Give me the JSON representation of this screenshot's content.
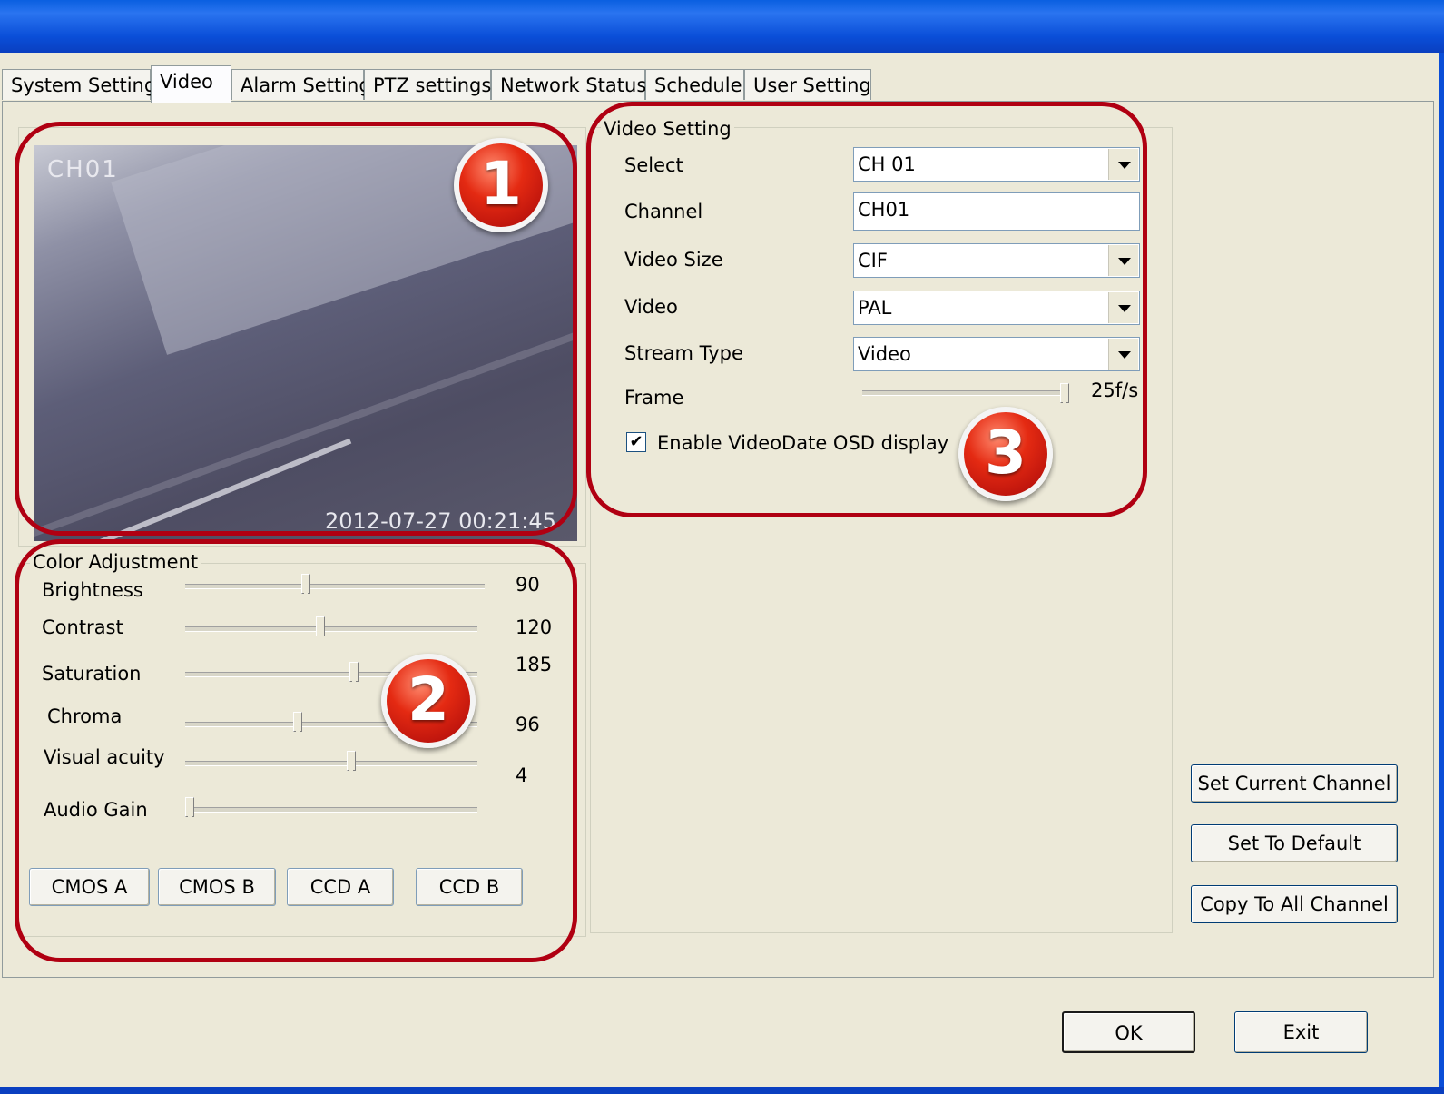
{
  "tabs": [
    "System Setting",
    "Video",
    "Alarm Setting",
    "PTZ settings",
    "Network Status",
    "Schedule",
    "User Setting"
  ],
  "active_tab": "Video",
  "video_preview": {
    "channel_osd": "CH01",
    "timestamp_osd": "2012-07-27 00:21:45"
  },
  "badges": [
    "1",
    "2",
    "3"
  ],
  "color_adjustment": {
    "title": "Color Adjustment",
    "sliders": [
      {
        "label": "Brightness",
        "value": "90",
        "level": 0.4
      },
      {
        "label": "Contrast",
        "value": "120",
        "level": 0.46
      },
      {
        "label": "Saturation",
        "value": "185",
        "level": 0.58
      },
      {
        "label": "Chroma",
        "value": "96",
        "level": 0.38
      },
      {
        "label": "Visual acuity",
        "value": "4",
        "level": 0.57
      },
      {
        "label": "Audio Gain",
        "value": "",
        "level": 0.0
      }
    ],
    "presets": [
      "CMOS A",
      "CMOS B",
      "CCD A",
      "CCD B"
    ]
  },
  "video_setting": {
    "title": "Video Setting",
    "select_label": "Select",
    "select_value": "CH 01",
    "channel_label": "Channel",
    "channel_value": "CH01",
    "video_size_label": "Video Size",
    "video_size_value": "CIF",
    "video_label": "Video",
    "video_value": "PAL",
    "stream_type_label": "Stream Type",
    "stream_type_value": "Video",
    "frame_label": "Frame",
    "frame_value": "25f/s",
    "frame_level": 1.0,
    "osd_checkbox_label": "Enable VideoDate OSD display",
    "osd_checked": true
  },
  "side_buttons": [
    "Set Current Channel",
    "Set To Default",
    "Copy To All Channel"
  ],
  "dialog_buttons": {
    "ok": "OK",
    "exit": "Exit"
  }
}
